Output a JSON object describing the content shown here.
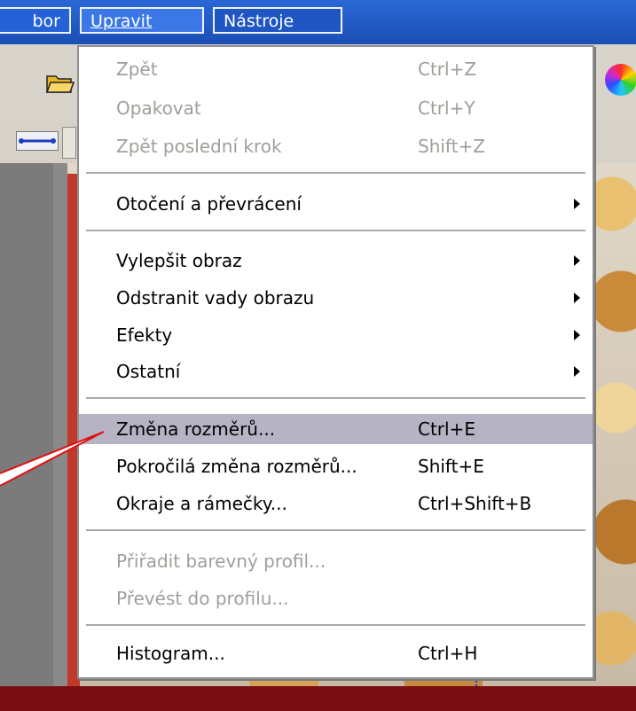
{
  "menubar": {
    "file_label": "bor",
    "edit_label": "Upravit",
    "tools_label": "Nástroje"
  },
  "menu": {
    "items": [
      {
        "label": "Zpět",
        "shortcut": "Ctrl+Z"
      },
      {
        "label": "Opakovat",
        "shortcut": "Ctrl+Y"
      },
      {
        "label": "Zpět poslední krok",
        "shortcut": "Shift+Z"
      },
      {
        "label": "Otočení a převrácení",
        "shortcut": ""
      },
      {
        "label": "Vylepšit obraz",
        "shortcut": ""
      },
      {
        "label": "Odstranit vady obrazu",
        "shortcut": ""
      },
      {
        "label": "Efekty",
        "shortcut": ""
      },
      {
        "label": "Ostatní",
        "shortcut": ""
      },
      {
        "label": "Změna rozměrů...",
        "shortcut": "Ctrl+E"
      },
      {
        "label": "Pokročilá změna rozměrů...",
        "shortcut": "Shift+E"
      },
      {
        "label": "Okraje a rámečky...",
        "shortcut": "Ctrl+Shift+B"
      },
      {
        "label": "Přiřadit barevný profil...",
        "shortcut": ""
      },
      {
        "label": "Převést do profilu...",
        "shortcut": ""
      },
      {
        "label": "Histogram...",
        "shortcut": "Ctrl+H"
      }
    ]
  },
  "icons": {
    "folder": "open-folder-icon",
    "color": "color-wheel-icon",
    "submenu_arrow": "submenu-arrow-icon"
  },
  "colors": {
    "highlight": "#b6b4c4",
    "disabled_text": "#a09e99",
    "menubar_blue": "#2562d8",
    "pointer_red": "#e01010"
  }
}
